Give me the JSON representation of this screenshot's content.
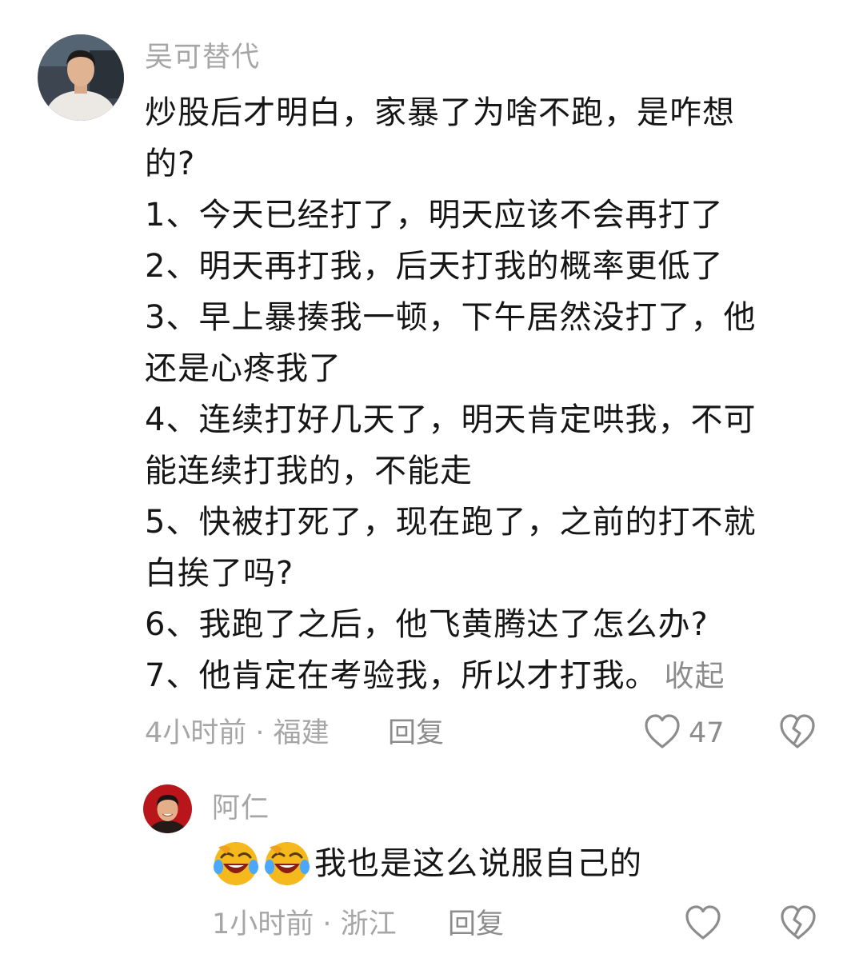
{
  "comment": {
    "username": "吴可替代",
    "lines": [
      "炒股后才明白，家暴了为啥不跑，是咋想",
      "的?",
      "1、今天已经打了，明天应该不会再打了",
      "2、明天再打我，后天打我的概率更低了",
      "3、早上暴揍我一顿，下午居然没打了，他",
      "还是心疼我了",
      "4、连续打好几天了，明天肯定哄我，不可",
      "能连续打我的，不能走",
      "5、快被打死了，现在跑了，之前的打不就",
      "白挨了吗?",
      "6、我跑了之后，他飞黄腾达了怎么办?",
      "7、他肯定在考验我，所以才打我。"
    ],
    "collapse_label": "收起",
    "meta": "4小时前 · 福建",
    "reply_label": "回复",
    "like_count": "47",
    "icons": {
      "like": "heart-outline-icon",
      "dislike": "broken-heart-icon"
    }
  },
  "reply": {
    "username": "阿仁",
    "emojis": [
      "laughing-crying-emoji",
      "laughing-crying-emoji"
    ],
    "text": "我也是这么说服自己的",
    "meta": "1小时前 · 浙江",
    "reply_label": "回复",
    "icons": {
      "like": "heart-outline-icon",
      "dislike": "broken-heart-icon"
    }
  },
  "colors": {
    "text": "#161616",
    "muted": "#a6a6a6",
    "action": "#8c8c8c",
    "emoji": "#f5b91e"
  }
}
